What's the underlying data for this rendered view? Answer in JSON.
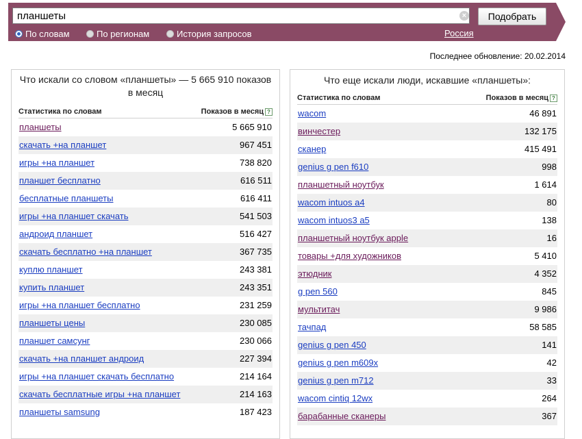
{
  "search": {
    "query": "планшеты",
    "submit_label": "Подобрать",
    "clear_glyph": "×",
    "modes": [
      "По словам",
      "По регионам",
      "История запросов"
    ],
    "region": "Россия"
  },
  "last_update": "Последнее обновление: 20.02.2014",
  "left_panel": {
    "title": "Что искали со словом «планшеты» — 5 665 910 показов в месяц",
    "col_keyword": "Статистика по словам",
    "col_count": "Показов в месяц",
    "help_glyph": "?",
    "rows": [
      {
        "kw": "планшеты",
        "count": "5 665 910"
      },
      {
        "kw": "скачать +на планшет",
        "count": "967 451"
      },
      {
        "kw": "игры +на планшет",
        "count": "738 820"
      },
      {
        "kw": "планшет бесплатно",
        "count": "616 511"
      },
      {
        "kw": "бесплатные планшеты",
        "count": "616 411"
      },
      {
        "kw": "игры +на планшет скачать",
        "count": "541 503"
      },
      {
        "kw": "андроид планшет",
        "count": "516 427"
      },
      {
        "kw": "скачать бесплатно +на планшет",
        "count": "367 735"
      },
      {
        "kw": "куплю планшет",
        "count": "243 381"
      },
      {
        "kw": "купить планшет",
        "count": "243 351"
      },
      {
        "kw": "игры +на планшет бесплатно",
        "count": "231 259"
      },
      {
        "kw": "планшеты цены",
        "count": "230 085"
      },
      {
        "kw": "планшет самсунг",
        "count": "230 066"
      },
      {
        "kw": "скачать +на планшет андроид",
        "count": "227 394"
      },
      {
        "kw": "игры +на планшет скачать бесплатно",
        "count": "214 164"
      },
      {
        "kw": "скачать бесплатные игры +на планшет",
        "count": "214 163"
      },
      {
        "kw": "планшеты samsung",
        "count": "187 423"
      }
    ]
  },
  "right_panel": {
    "title": "Что еще искали люди, искавшие «планшеты»:",
    "col_keyword": "Статистика по словам",
    "col_count": "Показов в месяц",
    "help_glyph": "?",
    "rows": [
      {
        "kw": "wacom",
        "count": "46 891"
      },
      {
        "kw": "винчестер",
        "count": "132 175"
      },
      {
        "kw": "сканер",
        "count": "415 491"
      },
      {
        "kw": "genius g pen f610",
        "count": "998"
      },
      {
        "kw": "планшетный ноутбук",
        "count": "1 614"
      },
      {
        "kw": "wacom intuos a4",
        "count": "80"
      },
      {
        "kw": "wacom intuos3 a5",
        "count": "138"
      },
      {
        "kw": "планшетный ноутбук apple",
        "count": "16"
      },
      {
        "kw": "товары +для художников",
        "count": "5 410"
      },
      {
        "kw": "этюдник",
        "count": "4 352"
      },
      {
        "kw": "g pen 560",
        "count": "845"
      },
      {
        "kw": "мультитач",
        "count": "9 986"
      },
      {
        "kw": "тачпад",
        "count": "58 585"
      },
      {
        "kw": "genius g pen 450",
        "count": "141"
      },
      {
        "kw": "genius g pen m609x",
        "count": "42"
      },
      {
        "kw": "genius g pen m712",
        "count": "33"
      },
      {
        "kw": "wacom cintiq 12wx",
        "count": "264"
      },
      {
        "kw": "барабанные сканеры",
        "count": "367"
      }
    ]
  },
  "colors": {
    "bar": "#8a4a65",
    "link": "#1a3dc1",
    "visited": "#6a1a5a",
    "stripe": "#efefef"
  }
}
